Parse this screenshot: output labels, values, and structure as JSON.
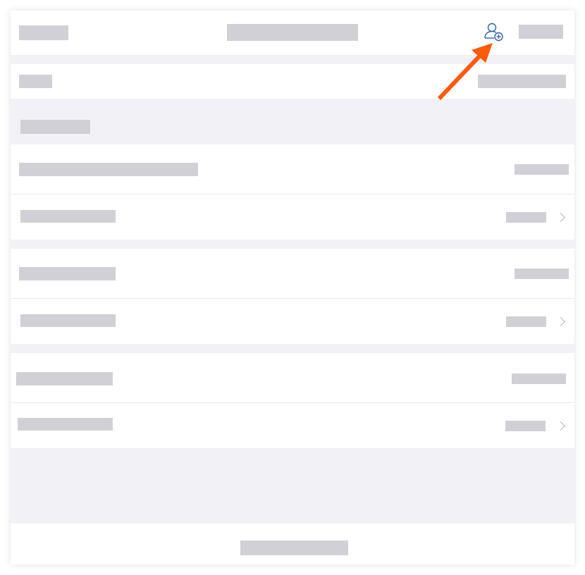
{
  "screen": {
    "header": {
      "left_label": "",
      "title": "",
      "right_label": "",
      "add_contact_icon": "person-add-icon"
    },
    "top_row": {
      "label": "",
      "value": ""
    },
    "section_header": "",
    "groups": [
      {
        "rows": [
          {
            "label": "",
            "value": ""
          },
          {
            "label": "",
            "value": ""
          }
        ]
      },
      {
        "rows": [
          {
            "label": "",
            "value": ""
          },
          {
            "label": "",
            "value": ""
          }
        ]
      },
      {
        "rows": [
          {
            "label": "",
            "value": ""
          },
          {
            "label": "",
            "value": ""
          }
        ]
      }
    ],
    "footer_label": ""
  },
  "annotation": {
    "arrow_color": "#ff5a0a",
    "target": "add-contact-button"
  },
  "colors": {
    "accent": "#2f5fb3",
    "background": "#f2f1f6",
    "placeholder_bar": "#d1d0d6"
  }
}
